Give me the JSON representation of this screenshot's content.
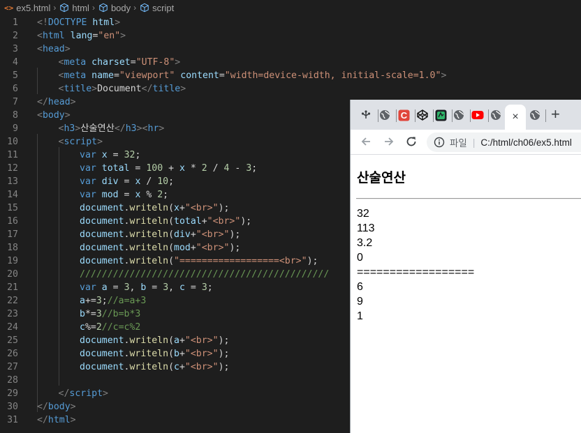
{
  "breadcrumb": {
    "file": "ex5.html",
    "crumbs": [
      "html",
      "body",
      "script"
    ]
  },
  "editor": {
    "lines": [
      {
        "n": "1",
        "indent": 0,
        "tokens": [
          [
            "br",
            "<!"
          ],
          [
            "tag",
            "DOCTYPE"
          ],
          [
            "txt",
            " "
          ],
          [
            "attr",
            "html"
          ],
          [
            "br",
            ">"
          ]
        ]
      },
      {
        "n": "2",
        "indent": 0,
        "tokens": [
          [
            "br",
            "<"
          ],
          [
            "tag",
            "html"
          ],
          [
            "txt",
            " "
          ],
          [
            "attr",
            "lang"
          ],
          [
            "txt",
            "="
          ],
          [
            "str",
            "\"en\""
          ],
          [
            "br",
            ">"
          ]
        ]
      },
      {
        "n": "3",
        "indent": 0,
        "tokens": [
          [
            "br",
            "<"
          ],
          [
            "tag",
            "head"
          ],
          [
            "br",
            ">"
          ]
        ]
      },
      {
        "n": "4",
        "indent": 1,
        "tokens": [
          [
            "br",
            "<"
          ],
          [
            "tag",
            "meta"
          ],
          [
            "txt",
            " "
          ],
          [
            "attr",
            "charset"
          ],
          [
            "txt",
            "="
          ],
          [
            "str",
            "\"UTF-8\""
          ],
          [
            "br",
            ">"
          ]
        ]
      },
      {
        "n": "5",
        "indent": 1,
        "tokens": [
          [
            "br",
            "<"
          ],
          [
            "tag",
            "meta"
          ],
          [
            "txt",
            " "
          ],
          [
            "attr",
            "name"
          ],
          [
            "txt",
            "="
          ],
          [
            "str",
            "\"viewport\""
          ],
          [
            "txt",
            " "
          ],
          [
            "attr",
            "content"
          ],
          [
            "txt",
            "="
          ],
          [
            "str",
            "\"width=device-width, initial-scale=1.0\""
          ],
          [
            "br",
            ">"
          ]
        ]
      },
      {
        "n": "6",
        "indent": 1,
        "tokens": [
          [
            "br",
            "<"
          ],
          [
            "tag",
            "title"
          ],
          [
            "br",
            ">"
          ],
          [
            "txt",
            "Document"
          ],
          [
            "br",
            "</"
          ],
          [
            "tag",
            "title"
          ],
          [
            "br",
            ">"
          ]
        ]
      },
      {
        "n": "7",
        "indent": 0,
        "tokens": [
          [
            "br",
            "</"
          ],
          [
            "tag",
            "head"
          ],
          [
            "br",
            ">"
          ]
        ]
      },
      {
        "n": "8",
        "indent": 0,
        "tokens": [
          [
            "br",
            "<"
          ],
          [
            "tag",
            "body"
          ],
          [
            "br",
            ">"
          ]
        ]
      },
      {
        "n": "9",
        "indent": 1,
        "tokens": [
          [
            "br",
            "<"
          ],
          [
            "tag",
            "h3"
          ],
          [
            "br",
            ">"
          ],
          [
            "txt",
            "산술연산"
          ],
          [
            "br",
            "</"
          ],
          [
            "tag",
            "h3"
          ],
          [
            "br",
            "><"
          ],
          [
            "tag",
            "hr"
          ],
          [
            "br",
            ">"
          ]
        ]
      },
      {
        "n": "10",
        "indent": 1,
        "tokens": [
          [
            "br",
            "<"
          ],
          [
            "tag",
            "script"
          ],
          [
            "br",
            ">"
          ]
        ]
      },
      {
        "n": "11",
        "indent": 2,
        "tokens": [
          [
            "kw",
            "var"
          ],
          [
            "op",
            " "
          ],
          [
            "var",
            "x"
          ],
          [
            "op",
            " = "
          ],
          [
            "num",
            "32"
          ],
          [
            "op",
            ";"
          ]
        ]
      },
      {
        "n": "12",
        "indent": 2,
        "tokens": [
          [
            "kw",
            "var"
          ],
          [
            "op",
            " "
          ],
          [
            "var",
            "total"
          ],
          [
            "op",
            " = "
          ],
          [
            "num",
            "100"
          ],
          [
            "op",
            " + "
          ],
          [
            "var",
            "x"
          ],
          [
            "op",
            " * "
          ],
          [
            "num",
            "2"
          ],
          [
            "op",
            " / "
          ],
          [
            "num",
            "4"
          ],
          [
            "op",
            " - "
          ],
          [
            "num",
            "3"
          ],
          [
            "op",
            ";"
          ]
        ]
      },
      {
        "n": "13",
        "indent": 2,
        "tokens": [
          [
            "kw",
            "var"
          ],
          [
            "op",
            " "
          ],
          [
            "var",
            "div"
          ],
          [
            "op",
            " = "
          ],
          [
            "var",
            "x"
          ],
          [
            "op",
            " / "
          ],
          [
            "num",
            "10"
          ],
          [
            "op",
            ";"
          ]
        ]
      },
      {
        "n": "14",
        "indent": 2,
        "tokens": [
          [
            "kw",
            "var"
          ],
          [
            "op",
            " "
          ],
          [
            "var",
            "mod"
          ],
          [
            "op",
            " = "
          ],
          [
            "var",
            "x"
          ],
          [
            "op",
            " % "
          ],
          [
            "num",
            "2"
          ],
          [
            "op",
            ";"
          ]
        ]
      },
      {
        "n": "15",
        "indent": 2,
        "tokens": [
          [
            "var",
            "document"
          ],
          [
            "op",
            "."
          ],
          [
            "fn",
            "writeln"
          ],
          [
            "op",
            "("
          ],
          [
            "var",
            "x"
          ],
          [
            "op",
            "+"
          ],
          [
            "str",
            "\"<br>\""
          ],
          [
            "op",
            ");"
          ]
        ]
      },
      {
        "n": "16",
        "indent": 2,
        "tokens": [
          [
            "var",
            "document"
          ],
          [
            "op",
            "."
          ],
          [
            "fn",
            "writeln"
          ],
          [
            "op",
            "("
          ],
          [
            "var",
            "total"
          ],
          [
            "op",
            "+"
          ],
          [
            "str",
            "\"<br>\""
          ],
          [
            "op",
            ");"
          ]
        ]
      },
      {
        "n": "17",
        "indent": 2,
        "tokens": [
          [
            "var",
            "document"
          ],
          [
            "op",
            "."
          ],
          [
            "fn",
            "writeln"
          ],
          [
            "op",
            "("
          ],
          [
            "var",
            "div"
          ],
          [
            "op",
            "+"
          ],
          [
            "str",
            "\"<br>\""
          ],
          [
            "op",
            ");"
          ]
        ]
      },
      {
        "n": "18",
        "indent": 2,
        "tokens": [
          [
            "var",
            "document"
          ],
          [
            "op",
            "."
          ],
          [
            "fn",
            "writeln"
          ],
          [
            "op",
            "("
          ],
          [
            "var",
            "mod"
          ],
          [
            "op",
            "+"
          ],
          [
            "str",
            "\"<br>\""
          ],
          [
            "op",
            ");"
          ]
        ]
      },
      {
        "n": "19",
        "indent": 2,
        "tokens": [
          [
            "var",
            "document"
          ],
          [
            "op",
            "."
          ],
          [
            "fn",
            "writeln"
          ],
          [
            "op",
            "("
          ],
          [
            "str",
            "\"==================<br>\""
          ],
          [
            "op",
            ");"
          ]
        ]
      },
      {
        "n": "20",
        "indent": 2,
        "tokens": [
          [
            "cm",
            "/////////////////////////////////////////////"
          ]
        ]
      },
      {
        "n": "21",
        "indent": 2,
        "tokens": [
          [
            "kw",
            "var"
          ],
          [
            "op",
            " "
          ],
          [
            "var",
            "a"
          ],
          [
            "op",
            " = "
          ],
          [
            "num",
            "3"
          ],
          [
            "op",
            ", "
          ],
          [
            "var",
            "b"
          ],
          [
            "op",
            " = "
          ],
          [
            "num",
            "3"
          ],
          [
            "op",
            ", "
          ],
          [
            "var",
            "c"
          ],
          [
            "op",
            " = "
          ],
          [
            "num",
            "3"
          ],
          [
            "op",
            ";"
          ]
        ]
      },
      {
        "n": "22",
        "indent": 2,
        "tokens": [
          [
            "var",
            "a"
          ],
          [
            "op",
            "+="
          ],
          [
            "num",
            "3"
          ],
          [
            "op",
            ";"
          ],
          [
            "cm",
            "//a=a+3"
          ]
        ]
      },
      {
        "n": "23",
        "indent": 2,
        "tokens": [
          [
            "var",
            "b"
          ],
          [
            "op",
            "*="
          ],
          [
            "num",
            "3"
          ],
          [
            "cm",
            "//b=b*3"
          ]
        ]
      },
      {
        "n": "24",
        "indent": 2,
        "tokens": [
          [
            "var",
            "c"
          ],
          [
            "op",
            "%="
          ],
          [
            "num",
            "2"
          ],
          [
            "cm",
            "//c=c%2"
          ]
        ]
      },
      {
        "n": "25",
        "indent": 2,
        "tokens": [
          [
            "var",
            "document"
          ],
          [
            "op",
            "."
          ],
          [
            "fn",
            "writeln"
          ],
          [
            "op",
            "("
          ],
          [
            "var",
            "a"
          ],
          [
            "op",
            "+"
          ],
          [
            "str",
            "\"<br>\""
          ],
          [
            "op",
            ");"
          ]
        ]
      },
      {
        "n": "26",
        "indent": 2,
        "tokens": [
          [
            "var",
            "document"
          ],
          [
            "op",
            "."
          ],
          [
            "fn",
            "writeln"
          ],
          [
            "op",
            "("
          ],
          [
            "var",
            "b"
          ],
          [
            "op",
            "+"
          ],
          [
            "str",
            "\"<br>\""
          ],
          [
            "op",
            ");"
          ]
        ]
      },
      {
        "n": "27",
        "indent": 2,
        "tokens": [
          [
            "var",
            "document"
          ],
          [
            "op",
            "."
          ],
          [
            "fn",
            "writeln"
          ],
          [
            "op",
            "("
          ],
          [
            "var",
            "c"
          ],
          [
            "op",
            "+"
          ],
          [
            "str",
            "\"<br>\""
          ],
          [
            "op",
            ");"
          ]
        ]
      },
      {
        "n": "28",
        "indent": 2,
        "tokens": []
      },
      {
        "n": "29",
        "indent": 1,
        "tokens": [
          [
            "br",
            "</"
          ],
          [
            "tag",
            "script"
          ],
          [
            "br",
            ">"
          ]
        ]
      },
      {
        "n": "30",
        "indent": 0,
        "tokens": [
          [
            "br",
            "</"
          ],
          [
            "tag",
            "body"
          ],
          [
            "br",
            ">"
          ]
        ]
      },
      {
        "n": "31",
        "indent": 0,
        "tokens": [
          [
            "br",
            "</"
          ],
          [
            "tag",
            "html"
          ],
          [
            "br",
            ">"
          ]
        ]
      }
    ]
  },
  "browser": {
    "tabs": [
      {
        "icon": "github-icon"
      },
      {
        "icon": "globe-icon"
      },
      {
        "icon": "c-red-icon"
      },
      {
        "icon": "codepen-icon"
      },
      {
        "icon": "green-app-icon"
      },
      {
        "icon": "globe-icon"
      },
      {
        "icon": "youtube-icon"
      },
      {
        "icon": "globe-icon"
      }
    ],
    "active_tab_close": "×",
    "after_tab_icon": "globe-icon",
    "new_tab_label": "+",
    "address": {
      "label": "파일",
      "separator": "|",
      "url": "C:/html/ch06/ex5.html"
    },
    "page": {
      "title": "산술연산",
      "output": [
        "32",
        "113",
        "3.2",
        "0",
        "==================",
        "6",
        "9",
        "1"
      ]
    }
  },
  "colors": {
    "editor_bg": "#1e1e1e",
    "tab_strip": "#dee1e6",
    "youtube_red": "#ff0000",
    "c_icon_red": "#e0453a"
  }
}
